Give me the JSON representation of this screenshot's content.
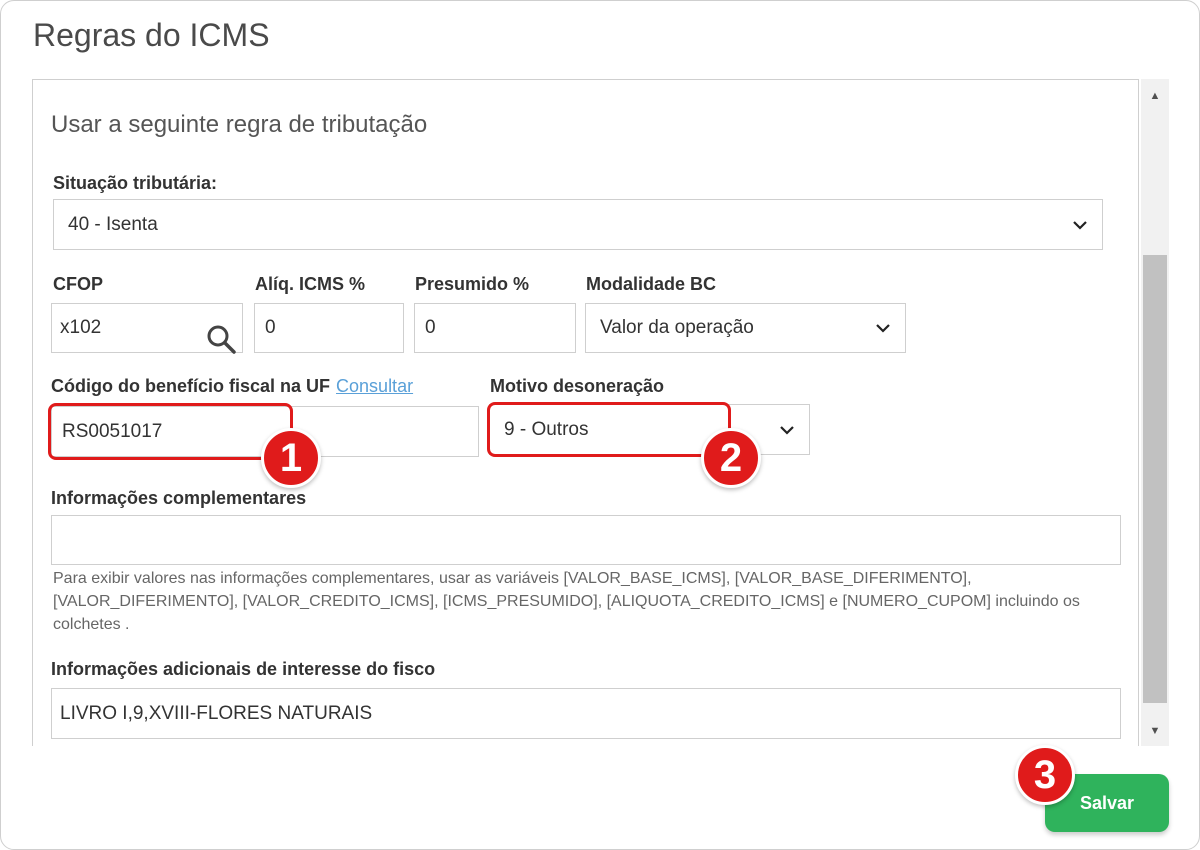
{
  "modal": {
    "title": "Regras do ICMS"
  },
  "section": {
    "title": "Usar a seguinte regra de tributação"
  },
  "situacao": {
    "label": "Situação tributária:",
    "value": "40 - Isenta"
  },
  "cfop": {
    "label": "CFOP",
    "value": "x102"
  },
  "aliq": {
    "label": "Alíq. ICMS %",
    "value": "0"
  },
  "presumido": {
    "label": "Presumido %",
    "value": "0"
  },
  "modalidade": {
    "label": "Modalidade BC",
    "value": "Valor da operação"
  },
  "beneficio": {
    "label": "Código do benefício fiscal na UF",
    "link": "Consultar",
    "value": "RS0051017"
  },
  "motivo": {
    "label": "Motivo desoneração",
    "value": "9 - Outros"
  },
  "info_comp": {
    "label": "Informações complementares",
    "value": "",
    "help": "Para exibir valores nas informações complementares, usar as variáveis [VALOR_BASE_ICMS], [VALOR_BASE_DIFERIMENTO], [VALOR_DIFERIMENTO], [VALOR_CREDITO_ICMS], [ICMS_PRESUMIDO], [ALIQUOTA_CREDITO_ICMS] e [NUMERO_CUPOM] incluindo os colchetes ."
  },
  "info_fisco": {
    "label": "Informações adicionais de interesse do fisco",
    "value": "LIVRO I,9,XVIII-FLORES NATURAIS"
  },
  "badges": {
    "one": "1",
    "two": "2",
    "three": "3"
  },
  "save": {
    "label": "Salvar"
  },
  "colors": {
    "accent": "#2fb35c",
    "highlight": "#e01b1b",
    "link": "#5aa0d8"
  },
  "icons": {
    "search": "search-icon",
    "chevron": "chevron-down-icon"
  }
}
